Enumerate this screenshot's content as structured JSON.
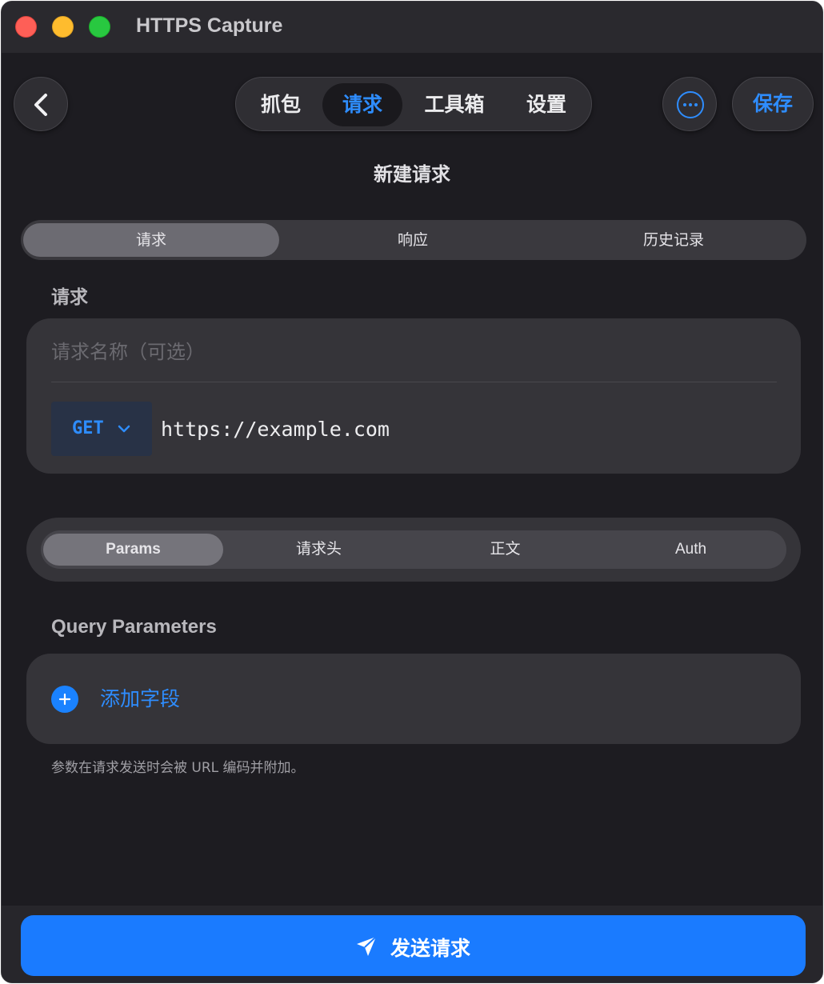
{
  "window": {
    "title": "HTTPS Capture"
  },
  "nav": {
    "tabs": [
      {
        "label": "抓包"
      },
      {
        "label": "请求"
      },
      {
        "label": "工具箱"
      },
      {
        "label": "设置"
      }
    ],
    "active_index": 1,
    "save_label": "保存"
  },
  "page": {
    "title": "新建请求"
  },
  "main_tabs": [
    {
      "label": "请求"
    },
    {
      "label": "响应"
    },
    {
      "label": "历史记录"
    }
  ],
  "request": {
    "section_label": "请求",
    "name_placeholder": "请求名称（可选）",
    "name_value": "",
    "method": "GET",
    "url": "https://example.com"
  },
  "sub_tabs": [
    {
      "label": "Params"
    },
    {
      "label": "请求头"
    },
    {
      "label": "正文"
    },
    {
      "label": "Auth"
    }
  ],
  "params": {
    "section_label": "Query Parameters",
    "add_label": "添加字段",
    "hint": "参数在请求发送时会被 URL 编码并附加。"
  },
  "footer": {
    "send_label": "发送请求"
  },
  "colors": {
    "accent": "#2e8dff",
    "send_button": "#1a7bff",
    "background": "#1d1c21"
  }
}
